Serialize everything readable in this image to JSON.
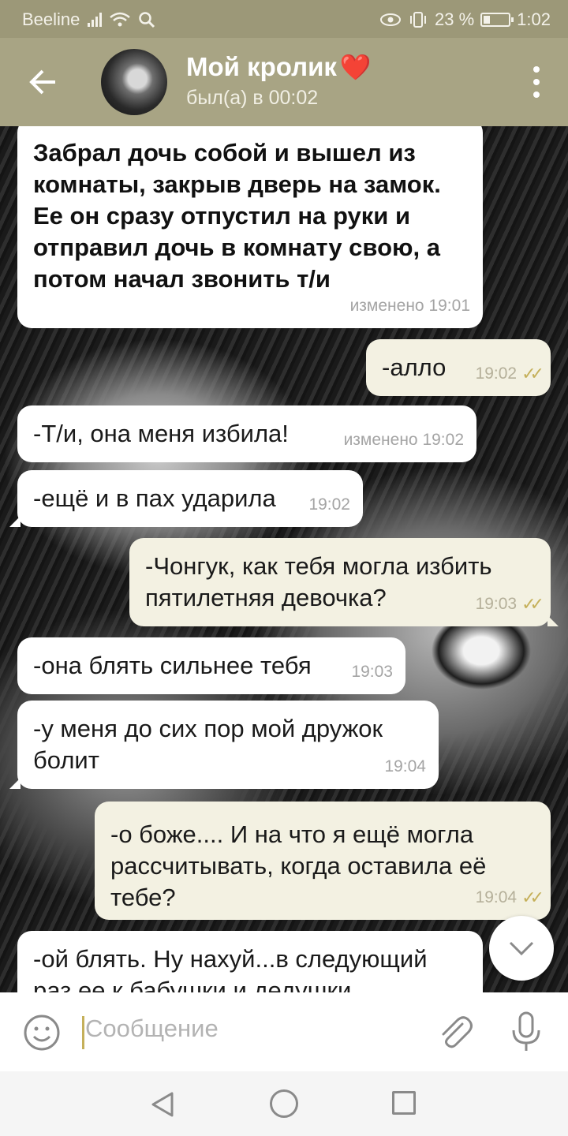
{
  "status_bar": {
    "carrier": "Beeline",
    "battery": "23 %",
    "battery_level": 0.23,
    "time": "1:02"
  },
  "header": {
    "title": "Мой кролик",
    "title_emoji": "❤️",
    "subtitle": "был(а) в 00:02",
    "back_icon": "arrow-left-icon",
    "menu_icon": "more-vert-icon"
  },
  "messages": [
    {
      "direction": "in",
      "text": "Забрал дочь собой и вышел из комнаты, закрыв дверь на замок. Ее он сразу отпустил на руки и отправил дочь в комнату свою, а потом начал звонить т/и",
      "meta": "изменено 19:01"
    },
    {
      "direction": "out",
      "text": "-алло",
      "meta": "19:02",
      "read": true
    },
    {
      "direction": "in",
      "text": "-Т/и, она меня избила!",
      "meta": "изменено 19:02"
    },
    {
      "direction": "in",
      "text": "-ещё и в пах ударила",
      "meta": "19:02"
    },
    {
      "direction": "out",
      "text": "-Чонгук, как тебя могла избить пятилетняя девочка?",
      "meta": "19:03",
      "read": true
    },
    {
      "direction": "in",
      "text": "-она блять сильнее тебя",
      "meta": "19:03"
    },
    {
      "direction": "in",
      "text": "-у меня до сих пор мой дружок болит",
      "meta": "19:04"
    },
    {
      "direction": "out",
      "text": "-о боже.... И на что я ещё могла рассчитывать, когда оставила её тебе?",
      "meta": "19:04",
      "read": true
    },
    {
      "direction": "in",
      "text": "-ой блять. Ну нахуй...в следующий раз ее к бабушки и дедушки",
      "meta": ""
    }
  ],
  "input": {
    "placeholder": "Сообщение",
    "emoji_icon": "emoji-icon",
    "attach_icon": "paperclip-icon",
    "mic_icon": "microphone-icon"
  },
  "colors": {
    "header": "#a8a484",
    "status_bar": "#9c9878",
    "outgoing_bubble": "#f3f1e2",
    "incoming_bubble": "#ffffff",
    "read_ticks": "#c5b05a"
  }
}
